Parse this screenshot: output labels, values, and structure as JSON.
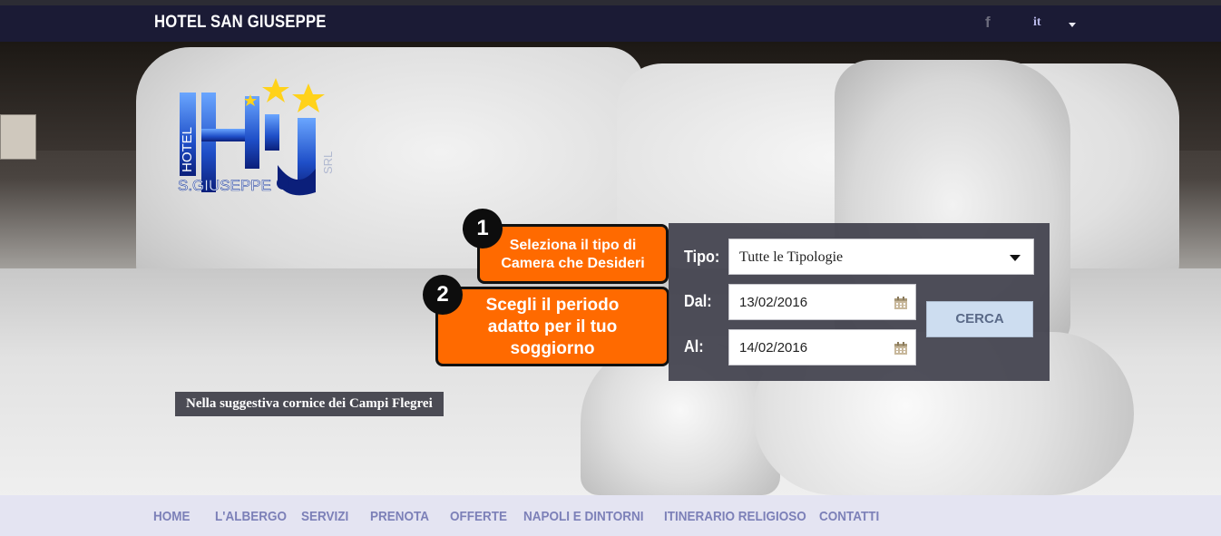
{
  "header": {
    "brand": "HOTEL SAN GIUSEPPE",
    "facebook_icon": "facebook-icon",
    "language": "it"
  },
  "hero": {
    "logo": {
      "word_hotel": "HOTEL",
      "word_name": "S.GIUSEPPE",
      "word_srl": "SRL",
      "letters": "HSJ"
    },
    "tagline": "Nella suggestiva cornice dei Campi Flegrei"
  },
  "callouts": [
    {
      "number": "1",
      "line1": "Seleziona il tipo di",
      "line2": "Camera che Desideri"
    },
    {
      "number": "2",
      "line1": "Scegli il periodo",
      "line2": "adatto per il tuo",
      "line3": "soggiorno"
    }
  ],
  "search_form": {
    "tipo_label": "Tipo:",
    "tipo_value": "Tutte le Tipologie",
    "dal_label": "Dal:",
    "dal_value": "13/02/2016",
    "al_label": "Al:",
    "al_value": "14/02/2016",
    "submit_label": "CERCA"
  },
  "nav": {
    "items": [
      {
        "label": "HOME"
      },
      {
        "label": "L'ALBERGO"
      },
      {
        "label": "SERVIZI"
      },
      {
        "label": "PRENOTA"
      },
      {
        "label": "OFFERTE"
      },
      {
        "label": "NAPOLI E DINTORNI"
      },
      {
        "label": "ITINERARIO RELIGIOSO"
      },
      {
        "label": "CONTATTI"
      }
    ]
  },
  "colors": {
    "topbar": "#1b1b35",
    "callout": "#ff6a00",
    "nav_text": "#7c80b8",
    "nav_bg": "#e4e4f2"
  }
}
